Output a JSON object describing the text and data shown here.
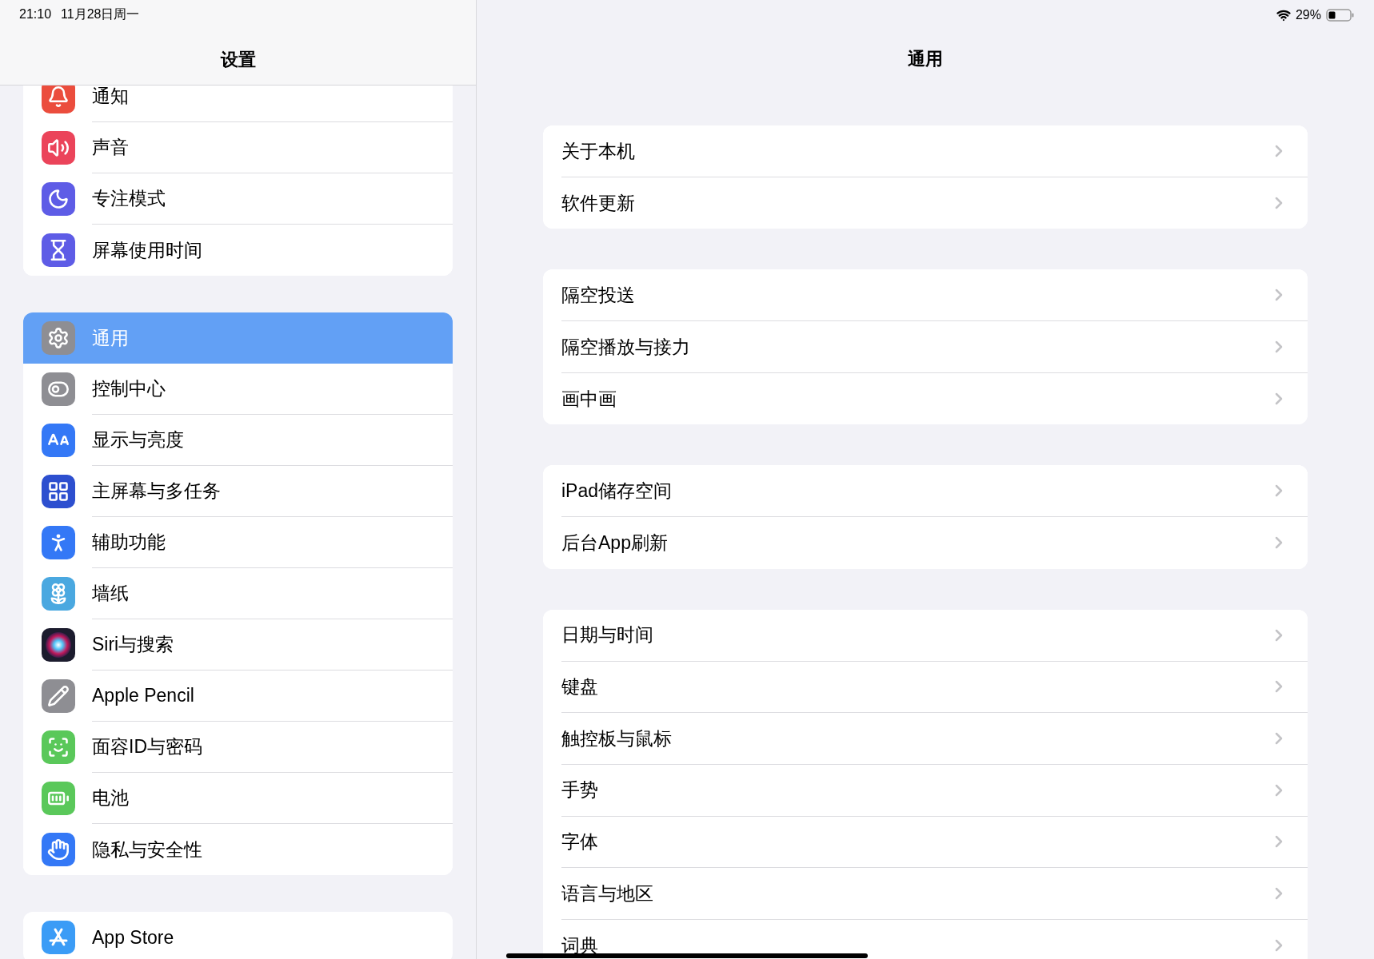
{
  "status_bar": {
    "time": "21:10",
    "date": "11月28日周一",
    "battery": "29%"
  },
  "sidebar": {
    "title": "设置",
    "groups": [
      {
        "items": [
          {
            "label": "通知",
            "kind": "bell",
            "color": "#eb4d3d",
            "selected": false
          },
          {
            "label": "声音",
            "kind": "sound",
            "color": "#eb445a",
            "selected": false
          },
          {
            "label": "专注模式",
            "kind": "moon",
            "color": "#5e5ce6",
            "selected": false
          },
          {
            "label": "屏幕使用时间",
            "kind": "hourglass",
            "color": "#5e5ce6",
            "selected": false
          }
        ]
      },
      {
        "items": [
          {
            "label": "通用",
            "kind": "gear",
            "color": "#8e8e93",
            "selected": true
          },
          {
            "label": "控制中心",
            "kind": "toggles",
            "color": "#8e8e93",
            "selected": false
          },
          {
            "label": "显示与亮度",
            "kind": "textsize",
            "color": "#3478f6",
            "selected": false
          },
          {
            "label": "主屏幕与多任务",
            "kind": "grid",
            "color": "#2d4fcf",
            "selected": false
          },
          {
            "label": "辅助功能",
            "kind": "person",
            "color": "#3478f6",
            "selected": false
          },
          {
            "label": "墙纸",
            "kind": "flower",
            "color": "#4aa8e0",
            "selected": false
          },
          {
            "label": "Siri与搜索",
            "kind": "orb",
            "color": "#1c1c2e",
            "selected": false
          },
          {
            "label": "Apple Pencil",
            "kind": "pencil",
            "color": "#8e8e93",
            "selected": false
          },
          {
            "label": "面容ID与密码",
            "kind": "face",
            "color": "#5ac85a",
            "selected": false
          },
          {
            "label": "电池",
            "kind": "battery",
            "color": "#5ac85a",
            "selected": false
          },
          {
            "label": "隐私与安全性",
            "kind": "hand",
            "color": "#3478f6",
            "selected": false
          }
        ]
      },
      {
        "items": [
          {
            "label": "App Store",
            "kind": "store",
            "color": "#3b9cf6",
            "selected": false
          }
        ]
      }
    ]
  },
  "detail": {
    "title": "通用",
    "groups": [
      {
        "items": [
          {
            "label": "关于本机"
          },
          {
            "label": "软件更新"
          }
        ]
      },
      {
        "items": [
          {
            "label": "隔空投送"
          },
          {
            "label": "隔空播放与接力"
          },
          {
            "label": "画中画"
          }
        ]
      },
      {
        "items": [
          {
            "label": "iPad储存空间"
          },
          {
            "label": "后台App刷新"
          }
        ]
      },
      {
        "items": [
          {
            "label": "日期与时间"
          },
          {
            "label": "键盘"
          },
          {
            "label": "触控板与鼠标"
          },
          {
            "label": "手势"
          },
          {
            "label": "字体"
          },
          {
            "label": "语言与地区"
          },
          {
            "label": "词典"
          }
        ]
      }
    ]
  }
}
